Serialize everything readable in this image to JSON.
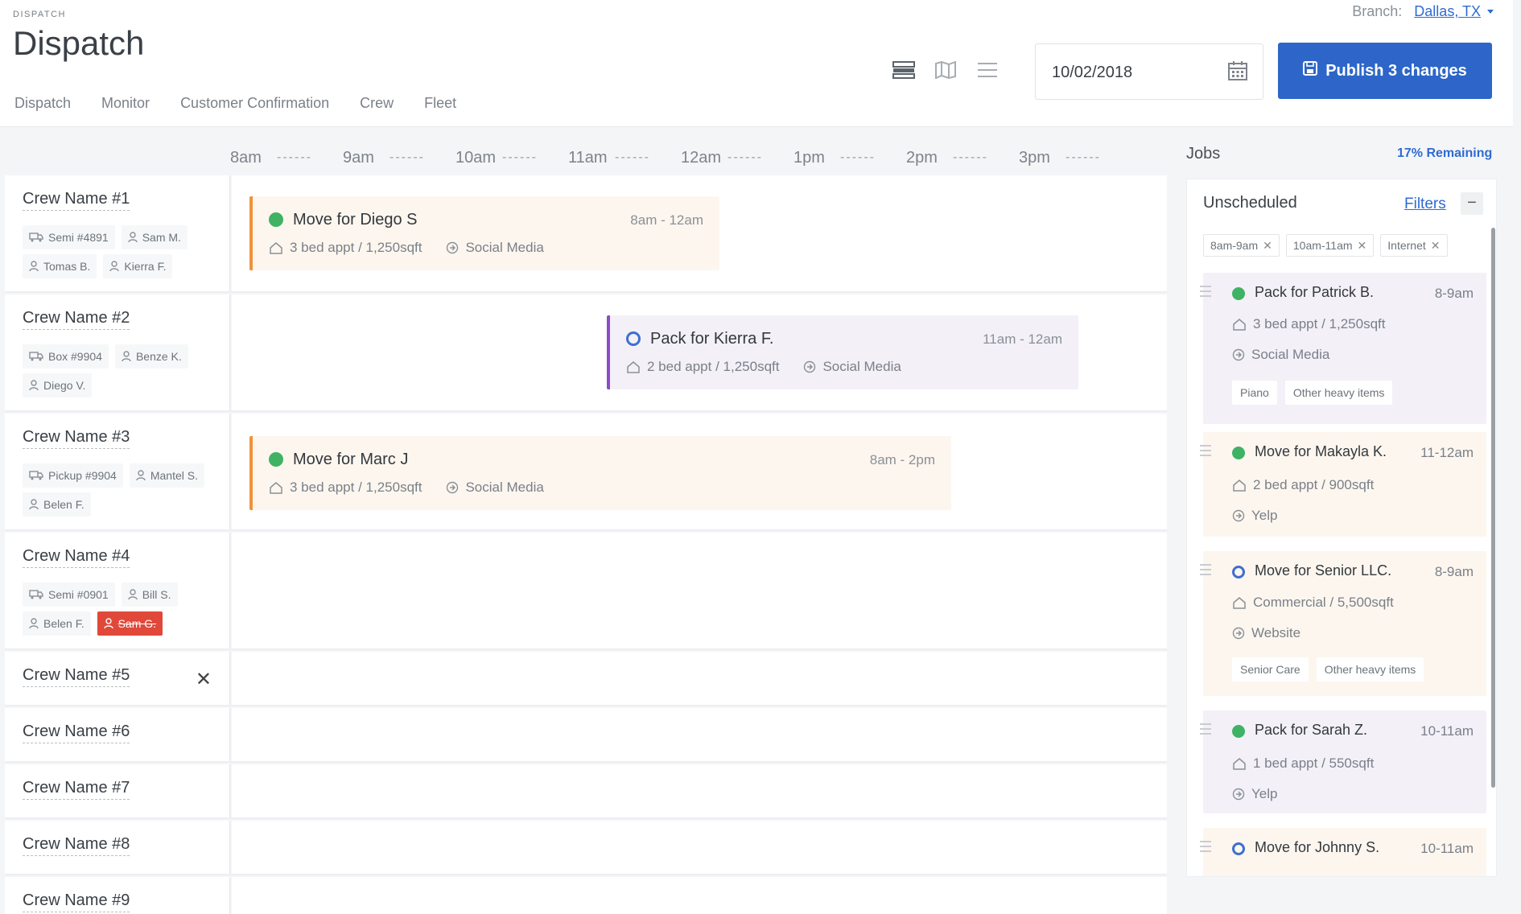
{
  "header": {
    "eyebrow": "DISPATCH",
    "title": "Dispatch",
    "branch_label": "Branch:",
    "branch_value": "Dallas, TX",
    "tabs": [
      "Dispatch",
      "Monitor",
      "Customer Confirmation",
      "Crew",
      "Fleet"
    ],
    "view_icons": [
      "timeline-view-icon",
      "map-view-icon",
      "list-view-icon"
    ],
    "date": "10/02/2018",
    "publish_label": "Publish 3 changes"
  },
  "timeline": {
    "hours": [
      "8am",
      "9am",
      "10am",
      "11am",
      "12am",
      "1pm",
      "2pm",
      "3pm"
    ]
  },
  "crews": [
    {
      "name": "Crew Name #1",
      "chips": [
        {
          "icon": "truck-icon",
          "label": "Semi #4891"
        },
        {
          "icon": "person-icon",
          "label": "Sam M."
        },
        {
          "icon": "person-icon",
          "label": "Tomas B."
        },
        {
          "icon": "person-icon",
          "label": "Kierra F."
        }
      ],
      "job": {
        "title": "Move for Diego S",
        "time": "8am - 12am",
        "details": "3 bed appt / 1,250sqft",
        "source": "Social Media",
        "status": "filled",
        "color": "orange"
      }
    },
    {
      "name": "Crew Name #2",
      "chips": [
        {
          "icon": "truck-icon",
          "label": "Box #9904"
        },
        {
          "icon": "person-icon",
          "label": "Benze K."
        },
        {
          "icon": "person-icon",
          "label": "Diego V."
        }
      ],
      "job": {
        "title": "Pack for Kierra F.",
        "time": "11am - 12am",
        "details": "2 bed appt / 1,250sqft",
        "source": "Social Media",
        "status": "open",
        "color": "purple"
      }
    },
    {
      "name": "Crew Name #3",
      "chips": [
        {
          "icon": "truck-icon",
          "label": "Pickup #9904"
        },
        {
          "icon": "person-icon",
          "label": "Mantel S."
        },
        {
          "icon": "person-icon",
          "label": "Belen F."
        }
      ],
      "job": {
        "title": "Move for Marc J",
        "time": "8am - 2pm",
        "details": "3 bed appt / 1,250sqft",
        "source": "Social Media",
        "status": "filled",
        "color": "orange"
      }
    },
    {
      "name": "Crew Name #4",
      "chips": [
        {
          "icon": "truck-icon",
          "label": "Semi #0901"
        },
        {
          "icon": "person-icon",
          "label": "Bill S."
        },
        {
          "icon": "person-icon",
          "label": "Belen F."
        },
        {
          "icon": "person-icon",
          "label": "Sam G.",
          "alert": true
        }
      ]
    },
    {
      "name": "Crew Name #5",
      "close": true
    },
    {
      "name": "Crew Name #6"
    },
    {
      "name": "Crew Name #7"
    },
    {
      "name": "Crew Name #8"
    },
    {
      "name": "Crew Name #9"
    }
  ],
  "jobs_panel": {
    "heading": "Jobs",
    "remaining": "17% Remaining",
    "title": "Unscheduled",
    "filters_label": "Filters",
    "collapse_label": "−",
    "filter_tags": [
      "8am-9am",
      "10am-11am",
      "Internet"
    ],
    "cards": [
      {
        "title": "Pack for Patrick B.",
        "time": "8-9am",
        "details": "3 bed appt / 1,250sqft",
        "source": "Social Media",
        "tags": [
          "Piano",
          "Other heavy items"
        ],
        "status": "filled",
        "color": "purple"
      },
      {
        "title": "Move for Makayla K.",
        "time": "11-12am",
        "details": "2 bed appt / 900sqft",
        "source": "Yelp",
        "tags": [],
        "status": "filled",
        "color": "orange"
      },
      {
        "title": "Move for Senior LLC.",
        "time": "8-9am",
        "details": "Commercial / 5,500sqft",
        "source": "Website",
        "tags": [
          "Senior Care",
          "Other heavy items"
        ],
        "status": "open",
        "color": "orange"
      },
      {
        "title": "Pack for Sarah Z.",
        "time": "10-11am",
        "details": "1 bed appt / 550sqft",
        "source": "Yelp",
        "tags": [],
        "status": "filled",
        "color": "purple"
      },
      {
        "title": "Move for Johnny S.",
        "time": "10-11am",
        "details": "",
        "source": "",
        "tags": [],
        "status": "open",
        "color": "orange"
      }
    ]
  },
  "colors": {
    "primary": "#2d66c8",
    "link": "#2f6bd1",
    "status_filled": "#3fb264",
    "status_open": "#3e6fcf",
    "move_accent": "#f0923a",
    "pack_accent": "#8d4cc9",
    "alert": "#e0483a"
  }
}
